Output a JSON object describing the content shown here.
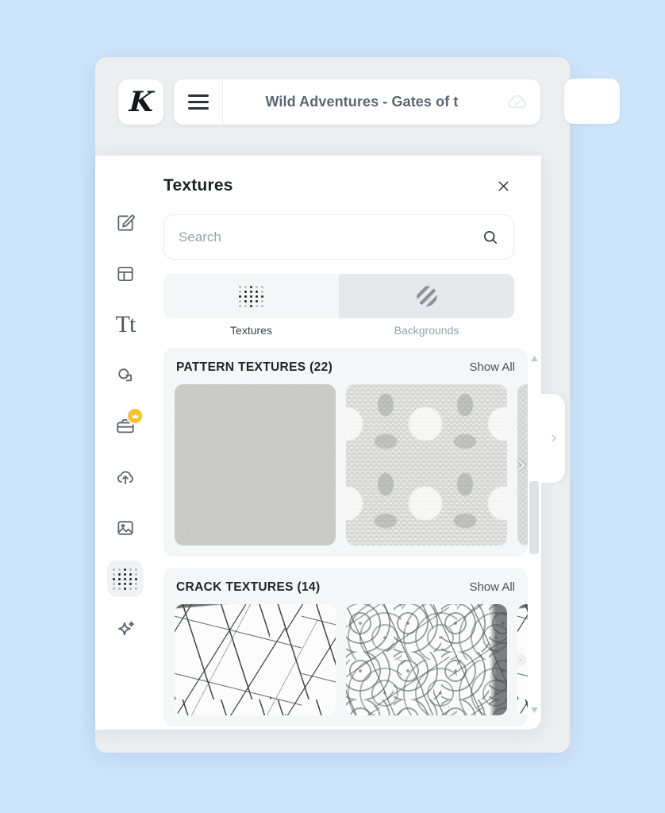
{
  "app": {
    "brand_logo_letter": "K",
    "logo_icon": "kittl-k-logo",
    "menu_icon": "hamburger-menu-icon",
    "document_title": "Wild Adventures - Gates of t",
    "save_state_icon": "cloud-check-icon",
    "background_color": "#cde4fb"
  },
  "sidebar": {
    "items": [
      {
        "id": "design",
        "label": "Design",
        "icon": "pencil-square-icon",
        "active": false,
        "badge": null
      },
      {
        "id": "templates",
        "label": "Templates",
        "icon": "layout-panels-icon",
        "active": false,
        "badge": null
      },
      {
        "id": "text",
        "label": "Text",
        "icon": "text-tt-icon",
        "active": false,
        "badge": null
      },
      {
        "id": "elements",
        "label": "Elements",
        "icon": "shapes-icon",
        "active": false,
        "badge": null
      },
      {
        "id": "brandkit",
        "label": "Brand Kit",
        "icon": "briefcase-icon",
        "active": false,
        "badge": "crown-icon"
      },
      {
        "id": "uploads",
        "label": "Uploads",
        "icon": "cloud-upload-icon",
        "active": false,
        "badge": null
      },
      {
        "id": "photos",
        "label": "Photos",
        "icon": "image-icon",
        "active": false,
        "badge": null
      },
      {
        "id": "textures",
        "label": "Textures",
        "icon": "dot-grid-icon",
        "active": true,
        "badge": null
      },
      {
        "id": "ai",
        "label": "AI",
        "icon": "sparkle-icon",
        "active": false,
        "badge": null
      }
    ]
  },
  "panel": {
    "title": "Textures",
    "close_icon": "close-icon",
    "search": {
      "placeholder": "Search",
      "value": "",
      "icon": "search-icon"
    },
    "tabs": [
      {
        "id": "textures",
        "label": "Textures",
        "icon": "dot-grid-icon",
        "selected": false
      },
      {
        "id": "backgrounds",
        "label": "Backgrounds",
        "icon": "diagonal-stripes-icon",
        "selected": true
      }
    ],
    "sections": [
      {
        "id": "pattern-textures",
        "title": "PATTERN TEXTURES (22)",
        "show_all_label": "Show All",
        "next_icon": "chevron-right-icon",
        "thumbnails": [
          {
            "id": "pattern-1",
            "style": "tex-willow",
            "alt": "willow leaf pattern texture"
          },
          {
            "id": "pattern-2",
            "style": "tex-damask",
            "alt": "damask ornamental pattern texture"
          },
          {
            "id": "pattern-3",
            "style": "tex-damask2",
            "alt": "floral damask pattern texture"
          }
        ]
      },
      {
        "id": "crack-textures",
        "title": "CRACK TEXTURES (14)",
        "show_all_label": "Show All",
        "next_icon": "chevron-right-icon",
        "thumbnails": [
          {
            "id": "crack-1",
            "style": "tex-crack1",
            "alt": "large crack texture"
          },
          {
            "id": "crack-2",
            "style": "tex-crack2",
            "alt": "fine crack grunge texture"
          },
          {
            "id": "crack-3",
            "style": "tex-crack1",
            "alt": "crack texture"
          }
        ]
      }
    ],
    "scrollbar": {
      "up_icon": "triangle-up-icon",
      "down_icon": "triangle-down-icon",
      "thumb": "scrollbar-thumb"
    },
    "collapse_handle_icon": "chevron-right-icon"
  }
}
